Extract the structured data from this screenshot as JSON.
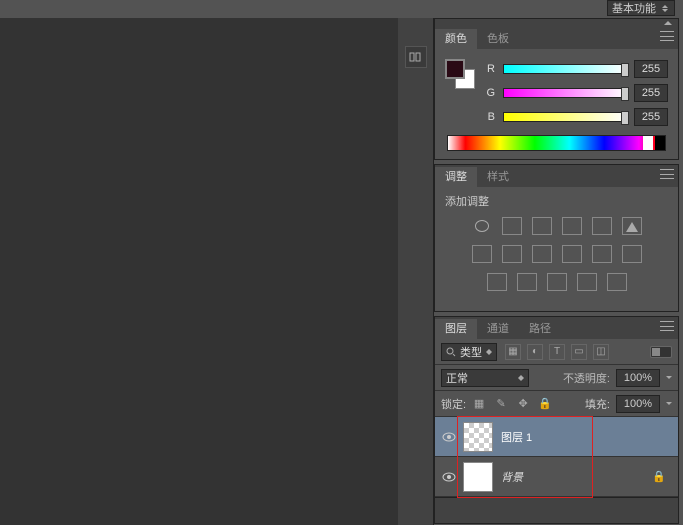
{
  "topbar": {
    "workspace_label": "基本功能"
  },
  "color_panel": {
    "tabs": [
      "颜色",
      "色板"
    ],
    "active_tab": 0,
    "channels": [
      {
        "label": "R",
        "value": "255"
      },
      {
        "label": "G",
        "value": "255"
      },
      {
        "label": "B",
        "value": "255"
      }
    ],
    "foreground": "#2a0a15",
    "background": "#ffffff"
  },
  "adjustments_panel": {
    "tabs": [
      "调整",
      "样式"
    ],
    "active_tab": 0,
    "title": "添加调整",
    "row1_icons": [
      "brightness-contrast",
      "levels",
      "curves",
      "exposure",
      "vibrance",
      "black-white"
    ],
    "row2_icons": [
      "photo-filter",
      "color-balance",
      "hue-saturation",
      "selective-color",
      "channel-mixer",
      "posterize"
    ],
    "row3_icons": [
      "gradient-map",
      "invert",
      "threshold",
      "color-lookup",
      "pattern"
    ]
  },
  "layers_panel": {
    "tabs": [
      "图层",
      "通道",
      "路径"
    ],
    "active_tab": 0,
    "filter_label": "类型",
    "filter_icons": [
      "image",
      "adjustment",
      "type",
      "shape",
      "smart-object"
    ],
    "blend_mode": "正常",
    "opacity_label": "不透明度:",
    "opacity_value": "100%",
    "lock_label": "锁定:",
    "lock_icons": [
      "transparent",
      "brush",
      "move",
      "all"
    ],
    "fill_label": "填充:",
    "fill_value": "100%",
    "layers": [
      {
        "name": "图层 1",
        "thumb": "transparent",
        "visible": true,
        "locked": false,
        "italic": false,
        "selected": true
      },
      {
        "name": "背景",
        "thumb": "white",
        "visible": true,
        "locked": true,
        "italic": true,
        "selected": false
      }
    ]
  }
}
